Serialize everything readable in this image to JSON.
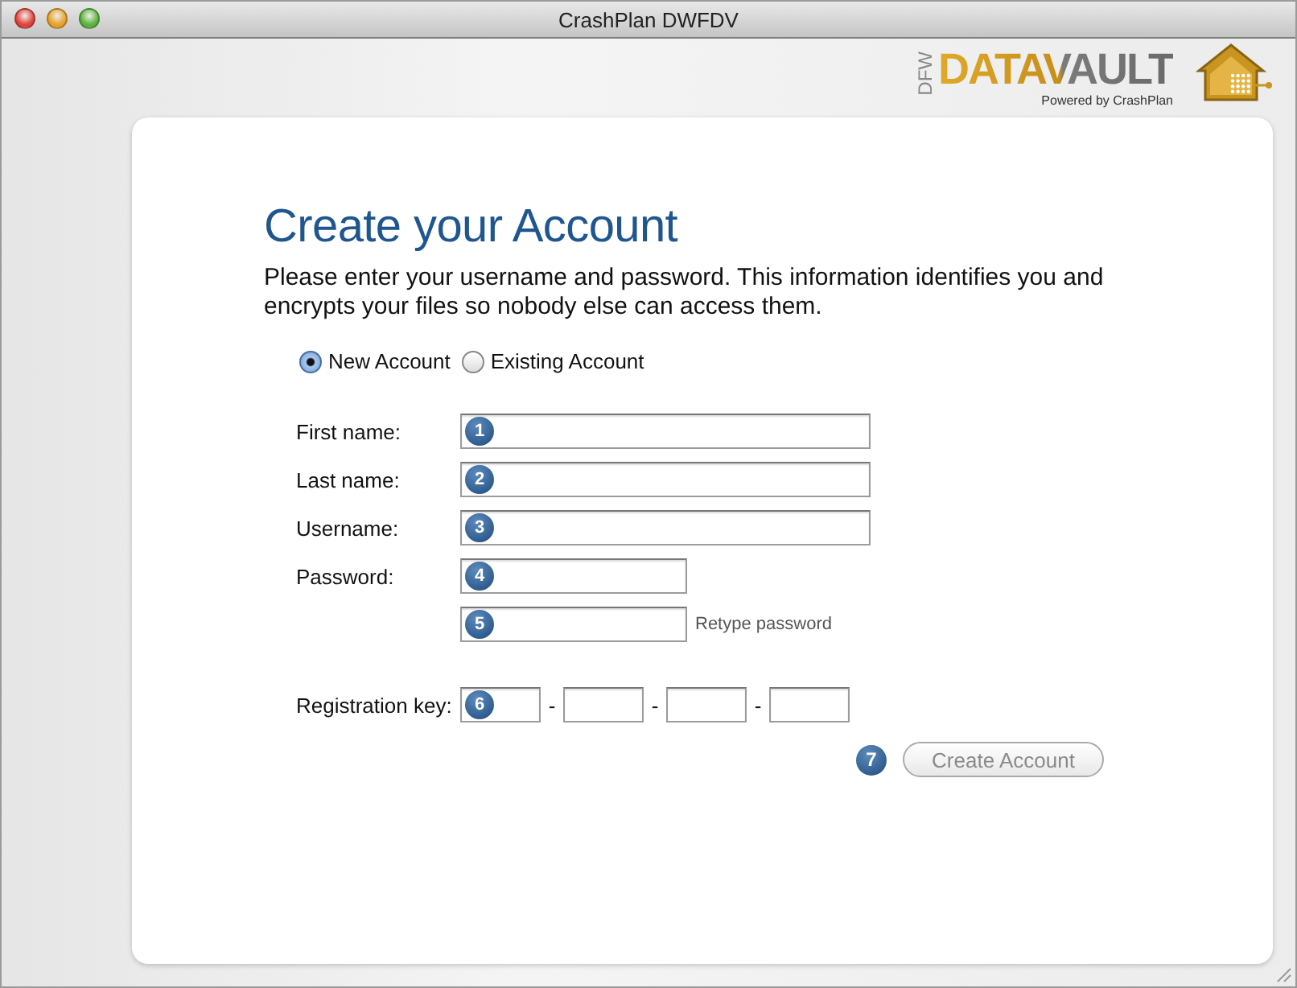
{
  "window": {
    "title": "CrashPlan DWFDV"
  },
  "logo": {
    "prefix": "DFW",
    "name": "DATAVAULT",
    "tagline": "Powered by CrashPlan"
  },
  "heading": "Create your Account",
  "intro": "Please enter your username and password. This information identifies you and encrypts your files so nobody else can access them.",
  "account_type": [
    {
      "label": "New Account",
      "selected": true
    },
    {
      "label": "Existing Account",
      "selected": false
    }
  ],
  "fields": [
    {
      "label": "First name:",
      "step": "1",
      "kind": "wide"
    },
    {
      "label": "Last name:",
      "step": "2",
      "kind": "wide"
    },
    {
      "label": "Username:",
      "step": "3",
      "kind": "wide"
    },
    {
      "label": "Password:",
      "step": "4",
      "kind": "short"
    },
    {
      "step": "5",
      "kind": "short",
      "hint": "Retype password"
    }
  ],
  "registration": {
    "label": "Registration key:",
    "step": "6",
    "separators": [
      "-",
      "-",
      "-"
    ]
  },
  "submit": {
    "step": "7",
    "label": "Create Account",
    "disabled": true
  }
}
